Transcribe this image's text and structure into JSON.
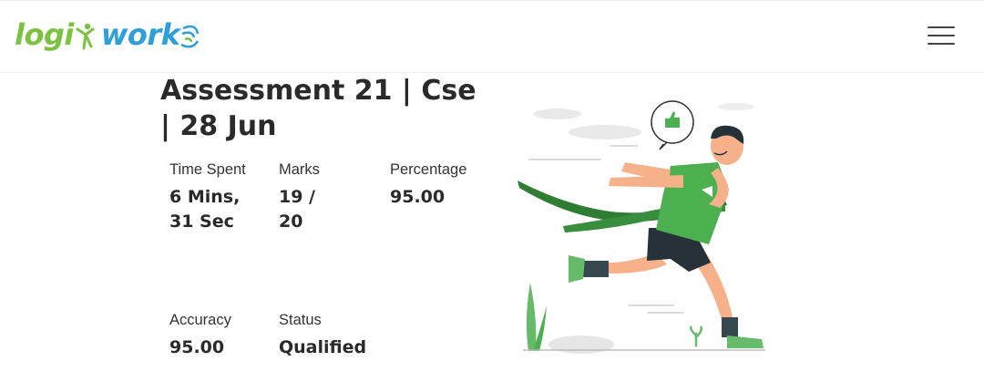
{
  "header": {
    "logo": {
      "part1": "logi",
      "part2": "work",
      "icon": "logiwork-logo"
    },
    "menu_icon": "hamburger-menu-icon"
  },
  "assessment": {
    "title": "Assessment 21 | Cse | 28 Jun"
  },
  "stats": {
    "time_spent": {
      "label": "Time Spent",
      "value": "6 Mins, 31 Sec"
    },
    "marks": {
      "label": "Marks",
      "value": "19 / 20"
    },
    "percentage": {
      "label": "Percentage",
      "value": "95.00"
    },
    "accuracy": {
      "label": "Accuracy",
      "value": "95.00"
    },
    "status": {
      "label": "Status",
      "value": "Qualified"
    }
  },
  "illustration": {
    "icon": "runner-finish-line-illustration"
  },
  "colors": {
    "brand_green": "#7cc242",
    "brand_blue": "#2e9fd8",
    "accent_green": "#4caf50"
  }
}
